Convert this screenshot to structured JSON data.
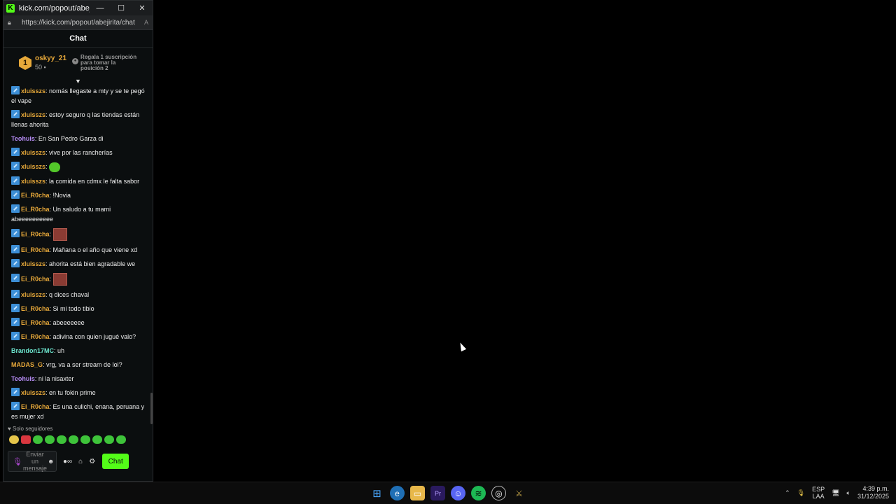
{
  "window": {
    "title": "kick.com/popout/abejir...",
    "url": "https://kick.com/popout/abejirita/chat"
  },
  "chat": {
    "header": "Chat",
    "leaderboard": {
      "rank": "1",
      "name": "oskyy_21",
      "count": "50",
      "gift_text": "Regala 1 suscripción para tomar la posición 2"
    },
    "colors": {
      "orange": "#e8a93a",
      "purple": "#b68cf5",
      "cyan": "#6ee7d0",
      "accent": "#53fc18"
    },
    "messages": [
      {
        "badge": true,
        "user": "xluisszs",
        "color": "#e8a93a",
        "text": "nomás llegaste a mty y se te pegó el vape"
      },
      {
        "badge": true,
        "user": "xluisszs",
        "color": "#e8a93a",
        "text": "estoy seguro q las tiendas están llenas ahorita"
      },
      {
        "badge": false,
        "user": "Teohuis",
        "color": "#b68cf5",
        "text": "En San Pedro Garza di"
      },
      {
        "badge": true,
        "user": "xluisszs",
        "color": "#e8a93a",
        "text": "vive por las rancherías"
      },
      {
        "badge": true,
        "user": "xluisszs",
        "color": "#e8a93a",
        "text": "",
        "emote": "frog"
      },
      {
        "badge": true,
        "user": "xluisszs",
        "color": "#e8a93a",
        "text": "la comida en cdmx le falta sabor"
      },
      {
        "badge": true,
        "user": "Ei_R0cha",
        "color": "#e8a93a",
        "text": "!Novia"
      },
      {
        "badge": true,
        "user": "Ei_R0cha",
        "color": "#e8a93a",
        "text": "Un saludo a tu mami abeeeeeeeeee"
      },
      {
        "badge": true,
        "user": "Ei_R0cha",
        "color": "#e8a93a",
        "text": "",
        "emote": "pic"
      },
      {
        "badge": true,
        "user": "Ei_R0cha",
        "color": "#e8a93a",
        "text": "Mañana o el año que viene xd"
      },
      {
        "badge": true,
        "user": "xluisszs",
        "color": "#e8a93a",
        "text": "ahorita está bien agradable we"
      },
      {
        "badge": true,
        "user": "Ei_R0cha",
        "color": "#e8a93a",
        "text": "",
        "emote": "pic"
      },
      {
        "badge": true,
        "user": "xluisszs",
        "color": "#e8a93a",
        "text": "q dices chaval"
      },
      {
        "badge": true,
        "user": "Ei_R0cha",
        "color": "#e8a93a",
        "text": "Si mi todo tibio"
      },
      {
        "badge": true,
        "user": "Ei_R0cha",
        "color": "#e8a93a",
        "text": "abeeeeeee"
      },
      {
        "badge": true,
        "user": "Ei_R0cha",
        "color": "#e8a93a",
        "text": "adivina con quien jugué valo?"
      },
      {
        "badge": false,
        "user": "Brandon17MC",
        "color": "#6ee7d0",
        "text": "uh"
      },
      {
        "badge": false,
        "user": "MADAS_G",
        "color": "#e8a93a",
        "text": "vrg, va a ser stream de lol?"
      },
      {
        "badge": false,
        "user": "Teohuis",
        "color": "#b68cf5",
        "text": "ni la nisaxter"
      },
      {
        "badge": true,
        "user": "xluisszs",
        "color": "#e8a93a",
        "text": "en tu fokin prime"
      },
      {
        "badge": true,
        "user": "Ei_R0cha",
        "color": "#e8a93a",
        "text": "Es una culichi, enana, peruana y es mujer xd"
      }
    ],
    "followers_label": "Solo seguidores",
    "input_placeholder": "Enviar un mensaje",
    "send_label": "Chat"
  },
  "taskbar": {
    "lang_top": "ESP",
    "lang_bottom": "LAA",
    "time": "4:39 p.m.",
    "date": "31/12/2025"
  }
}
